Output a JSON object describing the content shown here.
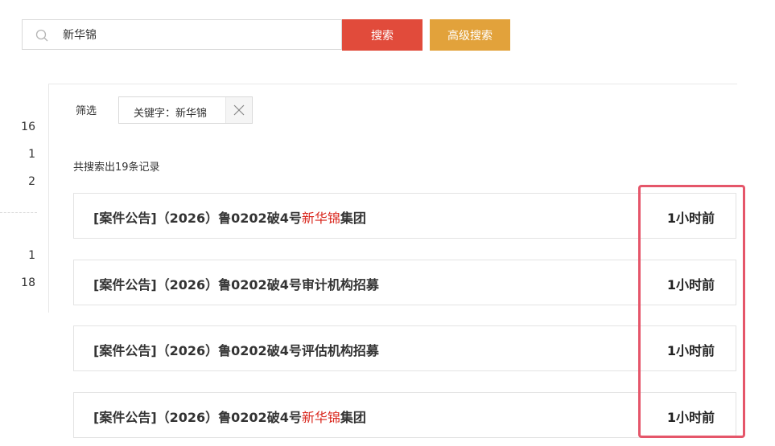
{
  "search": {
    "value": "新华锦",
    "button_label": "搜索",
    "advanced_label": "高级搜索"
  },
  "left_counts": [
    "16",
    "1",
    "2",
    "1",
    "18"
  ],
  "filter": {
    "label": "筛选",
    "tag_text": "关键字：新华锦"
  },
  "result_count": "共搜索出19条记录",
  "results": [
    {
      "prefix": "[案件公告]（2026）鲁0202破4号",
      "highlight": "新华锦",
      "suffix": "集团",
      "time": "1小时前"
    },
    {
      "prefix": "[案件公告]（2026）鲁0202破4号审计机构招募",
      "highlight": "",
      "suffix": "",
      "time": "1小时前"
    },
    {
      "prefix": "[案件公告]（2026）鲁0202破4号评估机构招募",
      "highlight": "",
      "suffix": "",
      "time": "1小时前"
    },
    {
      "prefix": "[案件公告]（2026）鲁0202破4号",
      "highlight": "新华锦",
      "suffix": "集团",
      "time": "1小时前"
    }
  ],
  "colors": {
    "search_button": "#e14b3b",
    "advanced_button": "#e2a23b",
    "keyword_highlight": "#d9261c",
    "annotation_box": "#e5566a"
  },
  "icons": {
    "search": "search-icon",
    "close": "close-icon"
  }
}
